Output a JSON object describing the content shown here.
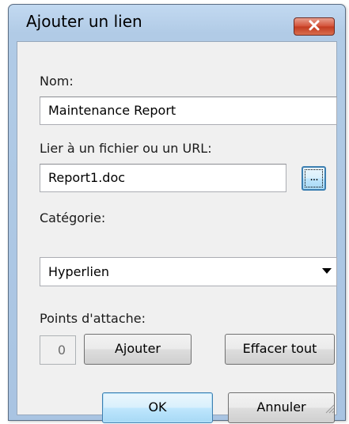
{
  "window": {
    "title": "Ajouter un lien"
  },
  "icons": {
    "close": "close-icon",
    "chevron": "chevron-down-icon",
    "grip": "resize-grip-icon"
  },
  "form": {
    "name_label": "Nom:",
    "name_value": "Maintenance Report",
    "link_label": "Lier à un fichier ou un URL:",
    "link_value": "Report1.doc",
    "browse_label": "...",
    "category_label": "Catégorie:",
    "category_value": "Hyperlien",
    "attach_label": "Points d'attache:",
    "attach_count": "0",
    "add_label": "Ajouter",
    "clear_label": "Effacer tout"
  },
  "footer": {
    "ok_label": "OK",
    "cancel_label": "Annuler"
  },
  "colors": {
    "title_bar": "#b1cbe6",
    "close_button": "#c33b20",
    "client_background": "#f0f0f0",
    "default_button": "#bee6fd"
  }
}
